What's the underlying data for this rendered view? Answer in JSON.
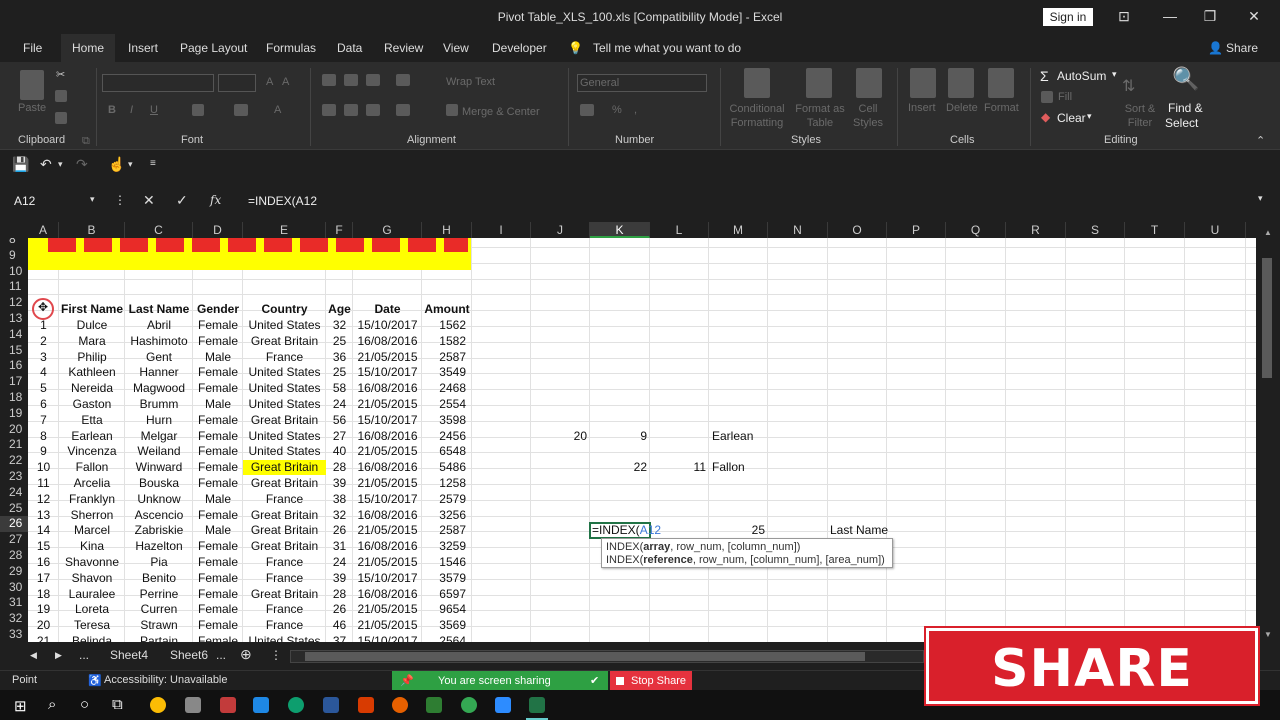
{
  "window": {
    "title": "Pivot Table_XLS_100.xls  [Compatibility Mode]  -  Excel",
    "sign_in": "Sign in",
    "minimize": "—",
    "restore": "❐",
    "close": "✕"
  },
  "tabs": [
    {
      "label": "File"
    },
    {
      "label": "Home"
    },
    {
      "label": "Insert"
    },
    {
      "label": "Page Layout"
    },
    {
      "label": "Formulas"
    },
    {
      "label": "Data"
    },
    {
      "label": "Review"
    },
    {
      "label": "View"
    },
    {
      "label": "Developer"
    }
  ],
  "tell_me": "Tell me what you want to do",
  "share": "Share",
  "ribbon": {
    "groups": {
      "clipboard": "Clipboard",
      "font": "Font",
      "alignment": "Alignment",
      "number": "Number",
      "styles": "Styles",
      "cells": "Cells",
      "editing": "Editing"
    },
    "paste": "Paste",
    "wrap_text": "Wrap Text",
    "merge_center": "Merge & Center",
    "number_format": "General",
    "conditional_formatting": "Conditional Formatting",
    "format_as_table": "Format as Table",
    "cell_styles": "Cell Styles",
    "insert": "Insert",
    "delete": "Delete",
    "format": "Format",
    "autosum": "AutoSum",
    "fill": "Fill",
    "clear": "Clear",
    "sort_filter": "Sort & Filter",
    "find_select_1": "Find &",
    "find_select_2": "Select"
  },
  "formula_bar": {
    "name_box": "A12",
    "fx": "fx",
    "formula": "=INDEX(A12"
  },
  "columns": [
    "A",
    "B",
    "C",
    "D",
    "E",
    "F",
    "G",
    "H",
    "I",
    "J",
    "K",
    "L",
    "M",
    "N",
    "O",
    "P",
    "Q",
    "R",
    "S",
    "T",
    "U"
  ],
  "rows": [
    "8",
    "9",
    "10",
    "11",
    "12",
    "13",
    "14",
    "15",
    "16",
    "17",
    "18",
    "19",
    "20",
    "21",
    "22",
    "23",
    "24",
    "25",
    "26",
    "27",
    "28",
    "29",
    "30",
    "31",
    "32",
    "33"
  ],
  "table": {
    "headers": [
      "First Name",
      "Last Name",
      "Gender",
      "Country",
      "Age",
      "Date",
      "Amount"
    ],
    "data": [
      [
        "1",
        "Dulce",
        "Abril",
        "Female",
        "United States",
        "32",
        "15/10/2017",
        "1562"
      ],
      [
        "2",
        "Mara",
        "Hashimoto",
        "Female",
        "Great Britain",
        "25",
        "16/08/2016",
        "1582"
      ],
      [
        "3",
        "Philip",
        "Gent",
        "Male",
        "France",
        "36",
        "21/05/2015",
        "2587"
      ],
      [
        "4",
        "Kathleen",
        "Hanner",
        "Female",
        "United States",
        "25",
        "15/10/2017",
        "3549"
      ],
      [
        "5",
        "Nereida",
        "Magwood",
        "Female",
        "United States",
        "58",
        "16/08/2016",
        "2468"
      ],
      [
        "6",
        "Gaston",
        "Brumm",
        "Male",
        "United States",
        "24",
        "21/05/2015",
        "2554"
      ],
      [
        "7",
        "Etta",
        "Hurn",
        "Female",
        "Great Britain",
        "56",
        "15/10/2017",
        "3598"
      ],
      [
        "8",
        "Earlean",
        "Melgar",
        "Female",
        "United States",
        "27",
        "16/08/2016",
        "2456"
      ],
      [
        "9",
        "Vincenza",
        "Weiland",
        "Female",
        "United States",
        "40",
        "21/05/2015",
        "6548"
      ],
      [
        "10",
        "Fallon",
        "Winward",
        "Female",
        "Great Britain",
        "28",
        "16/08/2016",
        "5486"
      ],
      [
        "11",
        "Arcelia",
        "Bouska",
        "Female",
        "Great Britain",
        "39",
        "21/05/2015",
        "1258"
      ],
      [
        "12",
        "Franklyn",
        "Unknow",
        "Male",
        "France",
        "38",
        "15/10/2017",
        "2579"
      ],
      [
        "13",
        "Sherron",
        "Ascencio",
        "Female",
        "Great Britain",
        "32",
        "16/08/2016",
        "3256"
      ],
      [
        "14",
        "Marcel",
        "Zabriskie",
        "Male",
        "Great Britain",
        "26",
        "21/05/2015",
        "2587"
      ],
      [
        "15",
        "Kina",
        "Hazelton",
        "Female",
        "Great Britain",
        "31",
        "16/08/2016",
        "3259"
      ],
      [
        "16",
        "Shavonne",
        "Pia",
        "Female",
        "France",
        "24",
        "21/05/2015",
        "1546"
      ],
      [
        "17",
        "Shavon",
        "Benito",
        "Female",
        "France",
        "39",
        "15/10/2017",
        "3579"
      ],
      [
        "18",
        "Lauralee",
        "Perrine",
        "Female",
        "Great Britain",
        "28",
        "16/08/2016",
        "6597"
      ],
      [
        "19",
        "Loreta",
        "Curren",
        "Female",
        "France",
        "26",
        "21/05/2015",
        "9654"
      ],
      [
        "20",
        "Teresa",
        "Strawn",
        "Female",
        "France",
        "46",
        "21/05/2015",
        "3569"
      ],
      [
        "21",
        "Belinda",
        "Partain",
        "Female",
        "United States",
        "37",
        "15/10/2017",
        "2564"
      ]
    ]
  },
  "side_cells": {
    "j20": "20",
    "k20": "9",
    "m20": "Earlean",
    "k22": "22",
    "l22": "11",
    "m22": "Fallon",
    "k26_prefix": "=INDEX(",
    "k26_ref": "A12",
    "m26": "25",
    "o26": "Last Name"
  },
  "tooltip": {
    "line1_fn": "INDEX(",
    "line1_bold": "array",
    "line1_rest": ", row_num, [column_num])",
    "line2_fn": "INDEX(",
    "line2_bold": "reference",
    "line2_rest": ", row_num, [column_num], [area_num])"
  },
  "sheets": {
    "ellipsis_left": "...",
    "tab1": "Sheet4",
    "tab2": "Sheet6",
    "ellipsis_right": "..."
  },
  "status": {
    "mode": "Point",
    "accessibility": "Accessibility: Unavailable"
  },
  "share_bar": {
    "sharing": "You are screen sharing",
    "stop": "Stop Share"
  },
  "overlay": {
    "share_text": "SHARE"
  },
  "colors": {
    "yellow": "#ffff00",
    "banner_red": "#e8202a",
    "share_red": "#d9202b",
    "zoom_green": "#2ea043",
    "stop_red": "#e5323e"
  }
}
